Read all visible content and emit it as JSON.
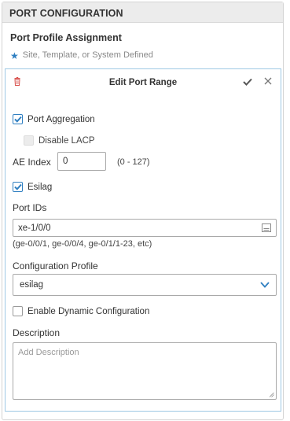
{
  "section": {
    "title": "PORT CONFIGURATION"
  },
  "assignment": {
    "title": "Port Profile Assignment",
    "subtitle": "Site, Template, or System Defined",
    "icon": "star-icon"
  },
  "edit_panel": {
    "title": "Edit Port Range",
    "icons": [
      "trash-icon",
      "check-icon",
      "close-icon"
    ],
    "port_aggregation": {
      "label": "Port Aggregation",
      "checked": true
    },
    "disable_lacp": {
      "label": "Disable LACP",
      "checked": false,
      "disabled": true
    },
    "ae_index": {
      "label": "AE Index",
      "value": "0",
      "range_hint": "(0 - 127)"
    },
    "esilag": {
      "label": "Esilag",
      "checked": true
    },
    "port_ids": {
      "label": "Port IDs",
      "value": "xe-1/0/0",
      "hint": "(ge-0/0/1, ge-0/0/4, ge-0/1/1-23, etc)"
    },
    "configuration_profile": {
      "label": "Configuration Profile",
      "selected": "esilag"
    },
    "dynamic_config": {
      "label": "Enable Dynamic Configuration",
      "checked": false
    },
    "description": {
      "label": "Description",
      "placeholder": "Add Description",
      "value": ""
    }
  },
  "colors": {
    "accent": "#2f7fc1",
    "border_focus": "#9ec9e4",
    "header_bg": "#ececec",
    "trash": "#d9534f"
  }
}
